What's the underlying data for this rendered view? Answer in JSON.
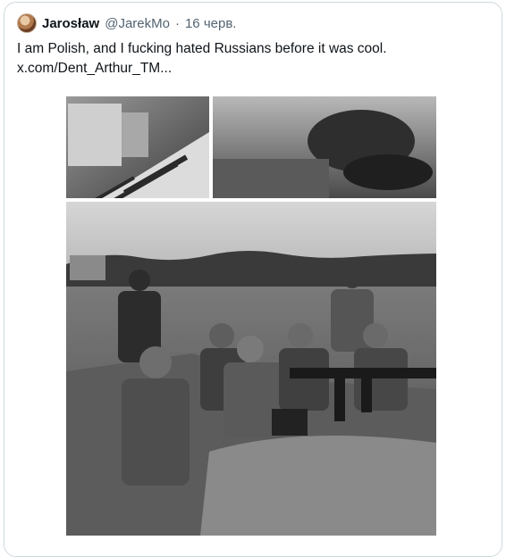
{
  "tweet": {
    "author_name": "Jarosław",
    "handle": "@JarekMo",
    "separator": "·",
    "date": "16 черв.",
    "text": "I am Polish, and I fucking hated Russians before it was cool.",
    "link": "x.com/Dent_Arthur_TM..."
  },
  "media": {
    "top_image": "archival-street-parade-and-trench-photo",
    "main_image": "archival-soldiers-in-trench-with-machine-gun-photo"
  },
  "colors": {
    "text": "#0f1419",
    "secondary": "#536471",
    "border": "#cfd9de"
  }
}
